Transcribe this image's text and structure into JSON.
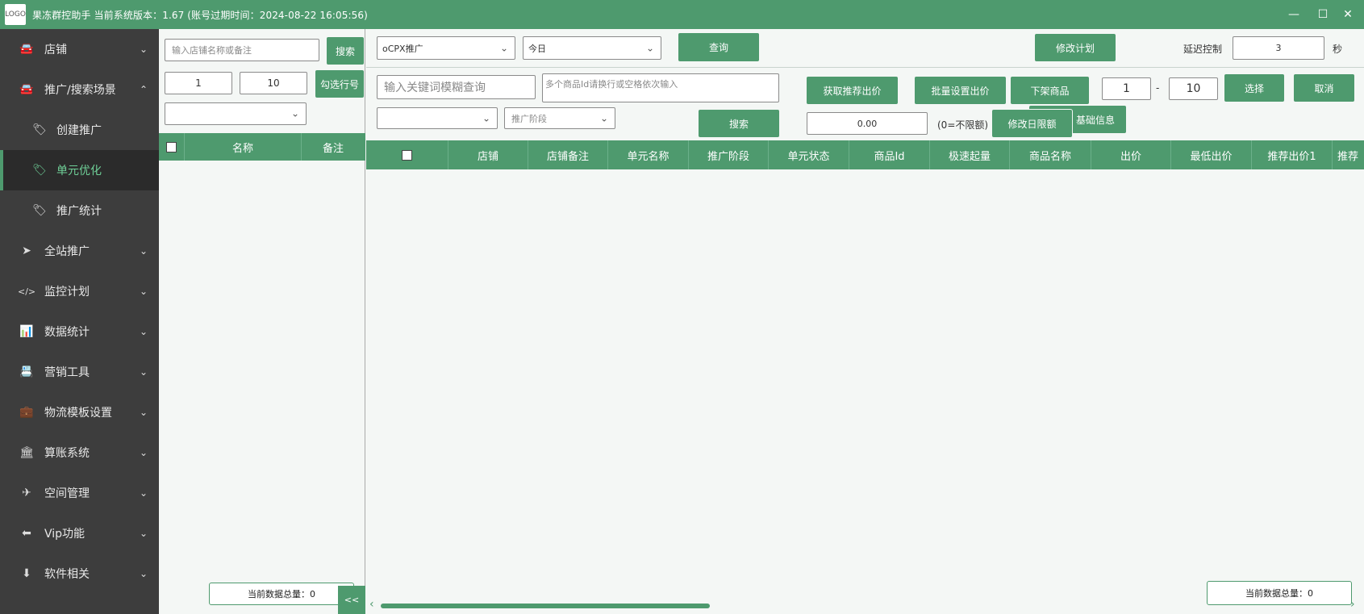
{
  "window": {
    "title": "果冻群控助手 当前系统版本：1.67  (账号过期时间：2024-08-22 16:05:56)",
    "logo_text": "LOGO",
    "controls": {
      "minimize": "—",
      "maximize": "☐",
      "close": "✕"
    }
  },
  "sidebar": {
    "items": [
      {
        "label": "店铺",
        "icon": "car-icon",
        "glyph": "🚘",
        "chevron": "⌄"
      },
      {
        "label": "推广/搜索场景",
        "icon": "car-icon",
        "glyph": "🚘",
        "chevron": "⌃"
      },
      {
        "label": "创建推广",
        "icon": "tag-icon",
        "glyph": "🏷"
      },
      {
        "label": "单元优化",
        "icon": "tag-icon",
        "glyph": "🏷"
      },
      {
        "label": "推广统计",
        "icon": "tag-icon",
        "glyph": "🏷"
      },
      {
        "label": "全站推广",
        "icon": "location-arrow-icon",
        "glyph": "➤",
        "chevron": "⌄"
      },
      {
        "label": "监控计划",
        "icon": "code-icon",
        "glyph": "</>",
        "chevron": "⌄"
      },
      {
        "label": "数据统计",
        "icon": "bar-chart-icon",
        "glyph": "📊",
        "chevron": "⌄"
      },
      {
        "label": "营销工具",
        "icon": "address-book-icon",
        "glyph": "📇",
        "chevron": "⌄"
      },
      {
        "label": "物流模板设置",
        "icon": "briefcase-icon",
        "glyph": "💼",
        "chevron": "⌄"
      },
      {
        "label": "算账系统",
        "icon": "bank-icon",
        "glyph": "🏛",
        "chevron": "⌄"
      },
      {
        "label": "空间管理",
        "icon": "plane-icon",
        "glyph": "✈",
        "chevron": "⌄"
      },
      {
        "label": "Vip功能",
        "icon": "arrow-left-icon",
        "glyph": "⬅",
        "chevron": "⌄"
      },
      {
        "label": "软件相关",
        "icon": "download-circle-icon",
        "glyph": "⬇",
        "chevron": "⌄"
      }
    ]
  },
  "left": {
    "shop_search_placeholder": "输入店铺名称或备注",
    "search_button": "搜索",
    "range_from": "1",
    "range_to": "10",
    "check_rows_button": "勾选行号",
    "dropdown_value": "",
    "dropdown_arrow": "⌄",
    "columns": [
      "名称",
      "备注"
    ],
    "total_label": "当前数据总量：0",
    "collapse_button": "<<"
  },
  "toolbar": {
    "plan_type": "oCPX推广",
    "date_range": "今日",
    "arrow": "⌄",
    "query_button": "查询",
    "modify_plan_button": "修改计划",
    "delay_label": "延迟控制",
    "delay_value": "3",
    "seconds_unit": "秒"
  },
  "filters": {
    "keyword_placeholder": "输入关键词模糊查询",
    "product_ids_placeholder": "多个商品Id请换行或空格依次输入",
    "get_recommended_bid_button": "获取推荐出价",
    "batch_set_bid_button": "批量设置出价",
    "delist_button": "下架商品",
    "range_from": "1",
    "range_dash": "-",
    "range_to": "10",
    "select_button": "选择",
    "cancel_button": "取消",
    "shop_select_value": "",
    "stage_placeholder": "推广阶段",
    "search_button": "搜索",
    "daily_limit_value": "0.00",
    "unlimited_hint": "(0=不限额)",
    "modify_daily_limit_button": "修改日限额",
    "basic_info_button": "修改基础信息",
    "basic_info_visible": "基础信息"
  },
  "table": {
    "columns": [
      "店铺",
      "店铺备注",
      "单元名称",
      "推广阶段",
      "单元状态",
      "商品Id",
      "极速起量",
      "商品名称",
      "出价",
      "最低出价",
      "推荐出价1",
      "推荐"
    ],
    "total_label": "当前数据总量：0",
    "scroll_left": "‹",
    "scroll_right": "›"
  },
  "colors": {
    "accent": "#4e9a6e",
    "sidebar_bg": "#3d3d3d",
    "active_bg": "#2b2b2b",
    "active_text": "#6fcf97"
  }
}
